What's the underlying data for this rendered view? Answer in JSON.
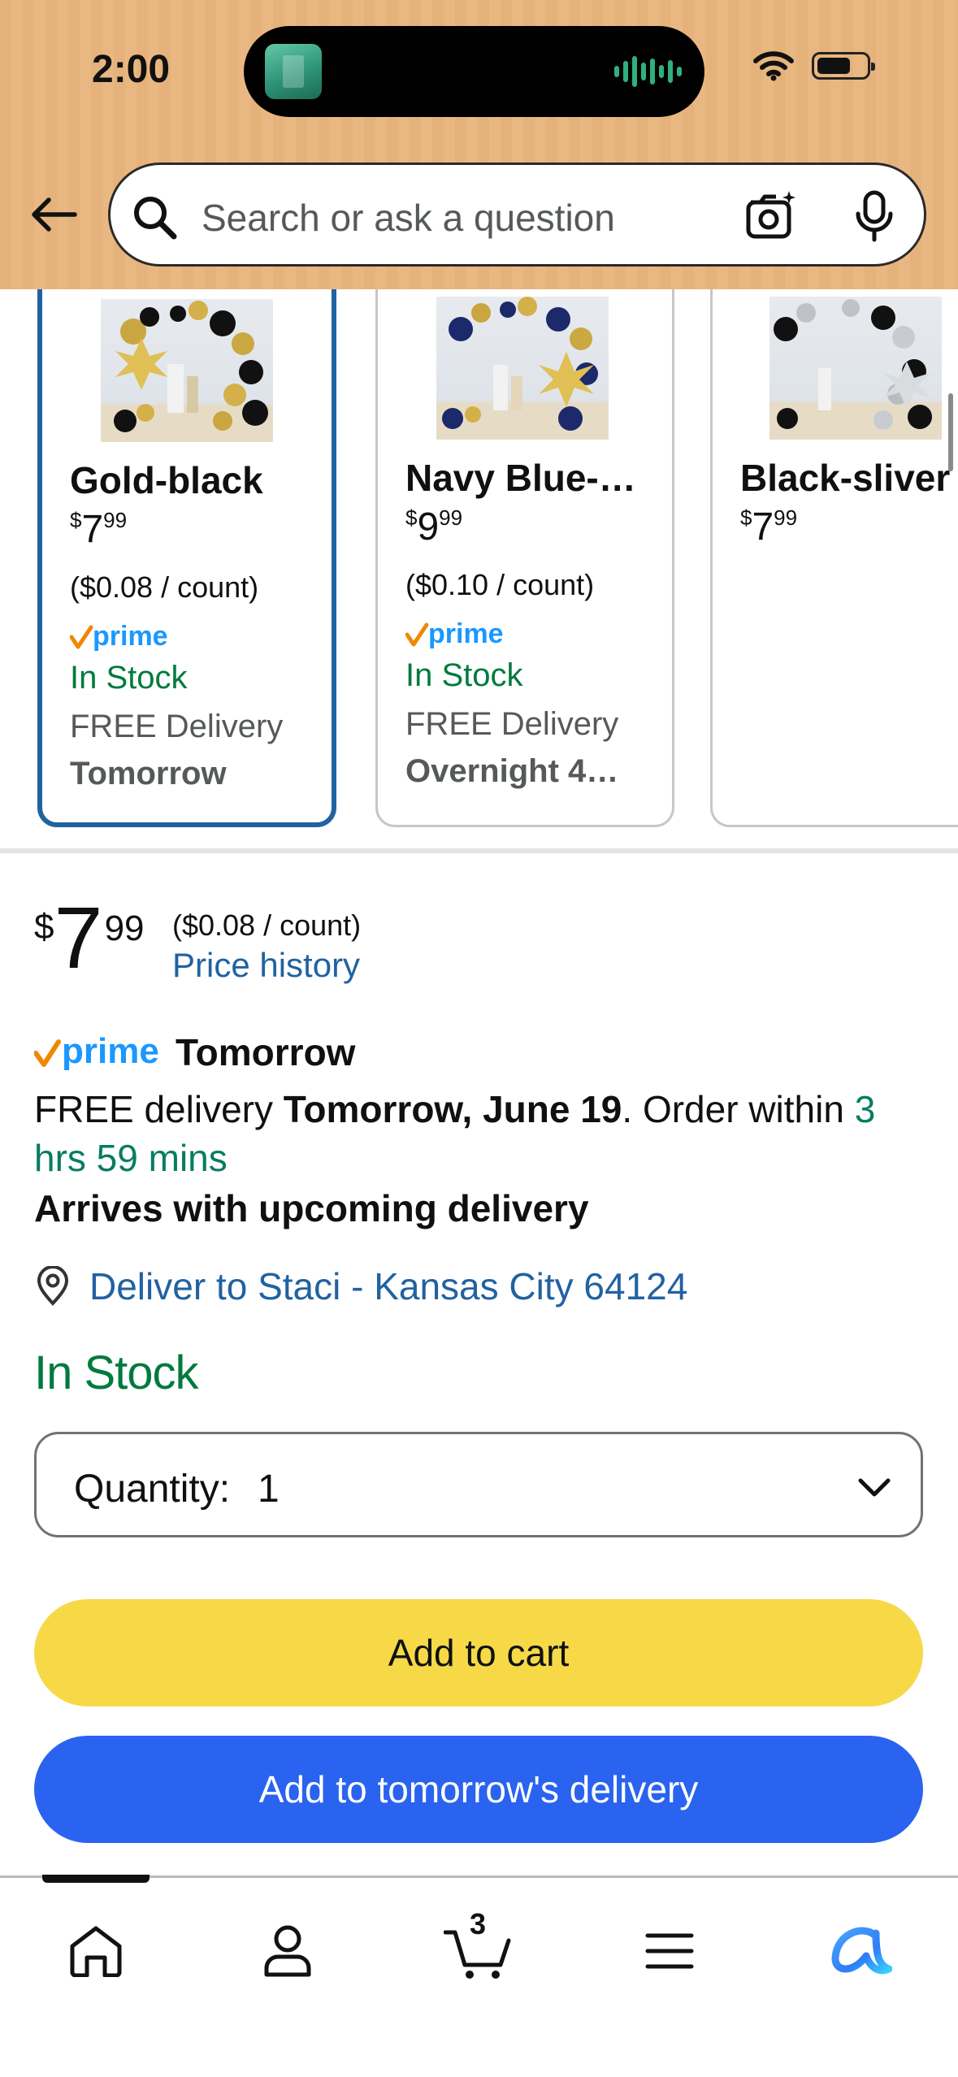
{
  "status_bar": {
    "time": "2:00"
  },
  "search": {
    "placeholder": "Search or ask a question"
  },
  "variants": [
    {
      "name": "Gold-black",
      "price_whole": "7",
      "price_fraction": "99",
      "unit_price": "($0.08 / count)",
      "stock": "In Stock",
      "delivery": "FREE Delivery",
      "delivery_when": "Tomorrow",
      "selected": true
    },
    {
      "name": "Navy Blue-…",
      "price_whole": "9",
      "price_fraction": "99",
      "unit_price": "($0.10 / count)",
      "stock": "In Stock",
      "delivery": "FREE Delivery",
      "delivery_when": "Overnight 4…",
      "selected": false
    },
    {
      "name": "Black-sliver",
      "price_whole": "7",
      "price_fraction": "99",
      "selected": false
    }
  ],
  "currency_symbol": "$",
  "buybox": {
    "price_whole": "7",
    "price_fraction": "99",
    "unit_price": "($0.08 / count)",
    "price_history": "Price history",
    "prime_word": "prime",
    "prime_label": "Tomorrow",
    "delivery_prefix": "FREE delivery ",
    "delivery_date": "Tomorrow, June 19",
    "delivery_mid": ". Order within ",
    "delivery_countdown": "3 hrs 59 mins",
    "arrives": "Arrives with upcoming delivery",
    "deliver_to": "Deliver to Staci - Kansas City 64124",
    "stock": "In Stock",
    "quantity_label": "Quantity:",
    "quantity_value": "1",
    "add_to_cart": "Add to cart",
    "add_to_delivery": "Add to tomorrow's delivery"
  },
  "nav": {
    "cart_count": "3",
    "active": "home"
  },
  "colors": {
    "prime_blue": "#1a98ff",
    "prime_check": "#f08804",
    "link": "#2162a1",
    "stock_green": "#007a3d",
    "cart_button": "#f7d948",
    "delivery_button": "#2a63ef"
  }
}
